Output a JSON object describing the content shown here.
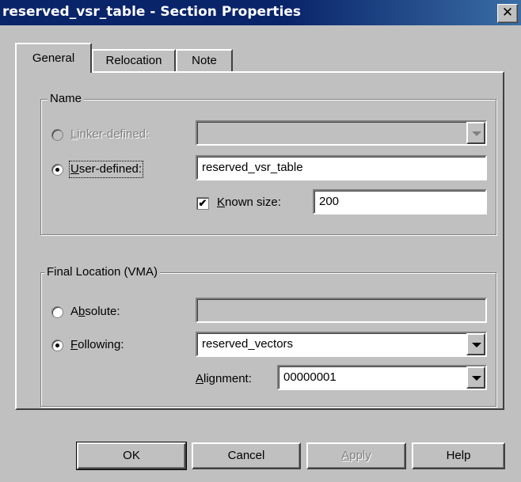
{
  "window": {
    "title": "reserved_vsr_table - Section Properties",
    "close_glyph": "✕"
  },
  "tabs": [
    {
      "label": "General",
      "active": true
    },
    {
      "label": "Relocation",
      "active": false
    },
    {
      "label": "Note",
      "active": false
    }
  ],
  "name_group": {
    "legend": "Name",
    "linker_defined": {
      "label": "Linker-defined:",
      "mnemonic": "L",
      "rest": "inker-defined:",
      "selected": false,
      "enabled": false,
      "value": ""
    },
    "user_defined": {
      "label": "User-defined:",
      "mnemonic": "U",
      "rest": "ser-defined:",
      "selected": true,
      "value": "reserved_vsr_table"
    },
    "known_size": {
      "label": "Known size:",
      "mnemonic": "K",
      "rest": "nown size:",
      "checked": true,
      "check_glyph": "✔",
      "value": "200"
    }
  },
  "location_group": {
    "legend": "Final Location (VMA)",
    "absolute": {
      "label": "Absolute:",
      "pre": "A",
      "mnemonic": "b",
      "rest": "solute:",
      "selected": false,
      "value": ""
    },
    "following": {
      "label": "Following:",
      "mnemonic": "F",
      "rest": "ollowing:",
      "selected": true,
      "value": "reserved_vectors"
    },
    "alignment": {
      "label": "Alignment:",
      "mnemonic": "A",
      "rest": "lignment:",
      "value": "00000001"
    }
  },
  "buttons": {
    "ok": "OK",
    "cancel": "Cancel",
    "apply": {
      "mnemonic": "A",
      "rest": "pply",
      "label": "Apply",
      "enabled": false
    },
    "help": "Help"
  },
  "colors": {
    "title_bar": "#0a246a",
    "face": "#c0c0c0"
  }
}
